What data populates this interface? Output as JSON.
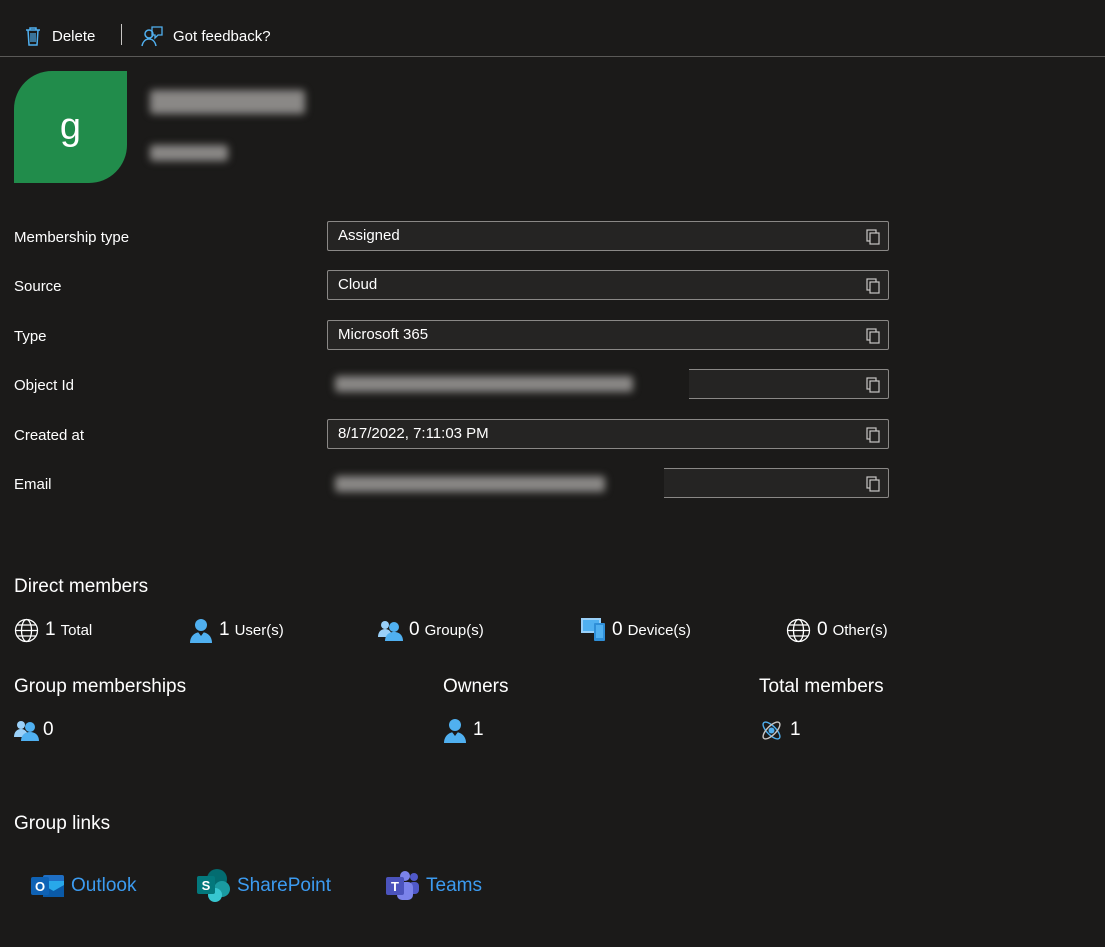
{
  "toolbar": {
    "delete_label": "Delete",
    "feedback_label": "Got feedback?"
  },
  "header": {
    "avatar_letter": "g"
  },
  "properties": {
    "membership_type": {
      "label": "Membership type",
      "value": "Assigned"
    },
    "source": {
      "label": "Source",
      "value": "Cloud"
    },
    "type": {
      "label": "Type",
      "value": "Microsoft 365"
    },
    "object_id": {
      "label": "Object Id"
    },
    "created_at": {
      "label": "Created at",
      "value": "8/17/2022, 7:11:03 PM"
    },
    "email": {
      "label": "Email"
    }
  },
  "direct_members": {
    "title": "Direct members",
    "total": {
      "count": "1",
      "label": "Total"
    },
    "users": {
      "count": "1",
      "label": "User(s)"
    },
    "groups": {
      "count": "0",
      "label": "Group(s)"
    },
    "devices": {
      "count": "0",
      "label": "Device(s)"
    },
    "others": {
      "count": "0",
      "label": "Other(s)"
    }
  },
  "summary": {
    "group_memberships": {
      "title": "Group memberships",
      "count": "0"
    },
    "owners": {
      "title": "Owners",
      "count": "1"
    },
    "total_members": {
      "title": "Total members",
      "count": "1"
    }
  },
  "group_links": {
    "title": "Group links",
    "outlook": "Outlook",
    "sharepoint": "SharePoint",
    "teams": "Teams"
  },
  "colors": {
    "background": "#1b1a19",
    "avatar": "#218c4b",
    "link": "#3c9bf0",
    "icon_blue": "#50b0f0"
  }
}
